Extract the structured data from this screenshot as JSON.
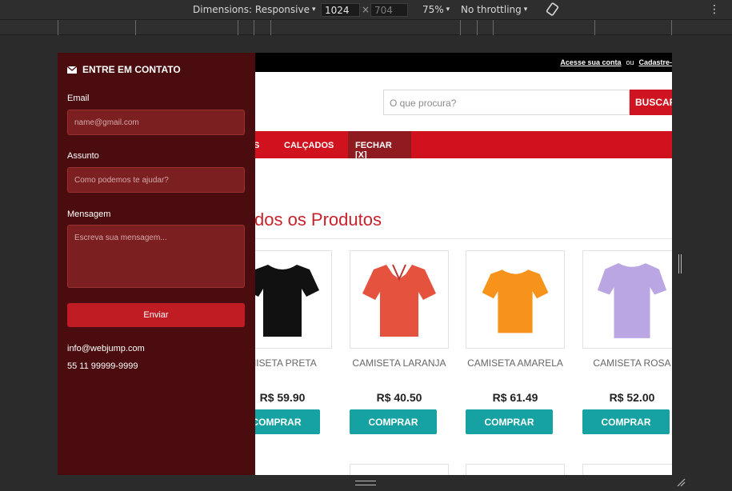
{
  "devtools": {
    "dimensions_label": "Dimensions: Responsive",
    "width": "1024",
    "times": "×",
    "height": "704",
    "zoom": "75%",
    "throttling": "No throttling",
    "caret": "▾",
    "more": "⋮"
  },
  "topbar": {
    "login_link": "Acesse sua conta",
    "or_text": "ou",
    "register_link": "Cadastre-"
  },
  "search": {
    "placeholder": "O que procura?",
    "button": "BUSCAR"
  },
  "nav": {
    "items": [
      "S",
      "CALÇADOS",
      "FECHAR [X]"
    ]
  },
  "page_title": "dos os Produtos",
  "products": [
    {
      "name": "MISETA PRETA",
      "price": "R$ 59.90",
      "buy": "COMPRAR",
      "color": "#111111"
    },
    {
      "name": "CAMISETA LARANJA",
      "price": "R$ 40.50",
      "buy": "COMPRAR",
      "color": "#e5533f"
    },
    {
      "name": "CAMISETA AMARELA",
      "price": "R$ 61.49",
      "buy": "COMPRAR",
      "color": "#f7931a"
    },
    {
      "name": "CAMISETA ROSA",
      "price": "R$ 52.00",
      "buy": "COMPRAR",
      "color": "#b9a6e3"
    }
  ],
  "contact": {
    "title": "ENTRE EM CONTATO",
    "email_label": "Email",
    "email_placeholder": "name@gmail.com",
    "subject_label": "Assunto",
    "subject_placeholder": "Como podemos te ajudar?",
    "message_label": "Mensagem",
    "message_placeholder": "Escreva sua mensagem...",
    "send": "Enviar",
    "email": "info@webjump.com",
    "phone": "55 11 99999-9999"
  },
  "colors": {
    "brand_red": "#d0121e",
    "sidebar_bg": "#4a0c0e",
    "buy_teal": "#16a2a2"
  }
}
